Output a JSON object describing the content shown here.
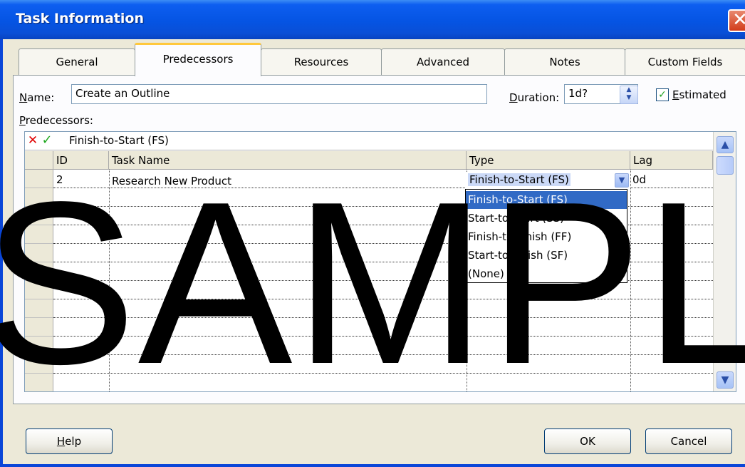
{
  "window": {
    "title": "Task Information",
    "close_glyph": "✕"
  },
  "tabs": [
    {
      "label": "General"
    },
    {
      "label": "Predecessors",
      "active": true
    },
    {
      "label": "Resources"
    },
    {
      "label": "Advanced"
    },
    {
      "label": "Notes"
    },
    {
      "label": "Custom Fields"
    }
  ],
  "name_field": {
    "label": "Name:",
    "value": "Create an Outline"
  },
  "duration_field": {
    "label": "Duration:",
    "value": "1d?"
  },
  "estimated": {
    "label": "Estimated",
    "checked": true
  },
  "predecessors_label": "Predecessors:",
  "edit_bar": {
    "cancel_icon": "x-icon",
    "accept_icon": "check-icon",
    "value": "Finish-to-Start (FS)"
  },
  "grid": {
    "columns": [
      "ID",
      "Task Name",
      "Type",
      "Lag"
    ],
    "rows": [
      {
        "id": "2",
        "task_name": "Research New Product",
        "type": "Finish-to-Start (FS)",
        "lag": "0d"
      }
    ]
  },
  "type_dropdown": {
    "options": [
      "Finish-to-Start (FS)",
      "Start-to-Start (SS)",
      "Finish-to-Finish (FF)",
      "Start-to-Finish (SF)",
      "(None)"
    ],
    "selected": "Finish-to-Start (FS)"
  },
  "buttons": {
    "help": "Help",
    "ok": "OK",
    "cancel": "Cancel"
  },
  "watermark": "SAMPL",
  "colors": {
    "titlebar": "#0554e3",
    "selection": "#316ac5",
    "tab_highlight": "#ffc83c"
  }
}
